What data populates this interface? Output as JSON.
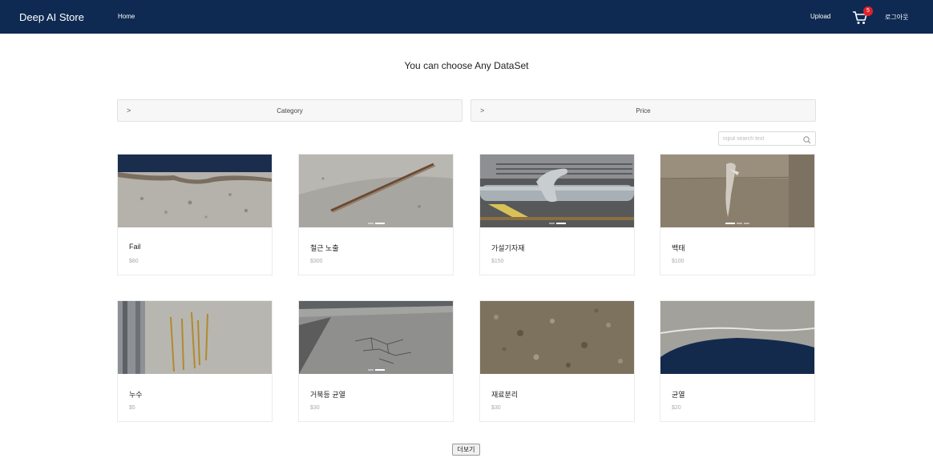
{
  "nav": {
    "brand": "Deep AI Store",
    "home": "Home",
    "upload": "Upload",
    "cart_count": "5",
    "logout": "로그아웃"
  },
  "title": "You can choose Any DataSet",
  "filters": {
    "chevron": ">",
    "category": "Category",
    "price": "Price"
  },
  "search": {
    "placeholder": "input search text"
  },
  "products": [
    {
      "name": "Fail",
      "price": "$80"
    },
    {
      "name": "철근 노출",
      "price": "$300"
    },
    {
      "name": "가설기자재",
      "price": "$150"
    },
    {
      "name": "백태",
      "price": "$100"
    },
    {
      "name": "누수",
      "price": "$5"
    },
    {
      "name": "거북등 균열",
      "price": "$30"
    },
    {
      "name": "재료분리",
      "price": "$30"
    },
    {
      "name": "균열",
      "price": "$20"
    }
  ],
  "more_label": "더보기"
}
